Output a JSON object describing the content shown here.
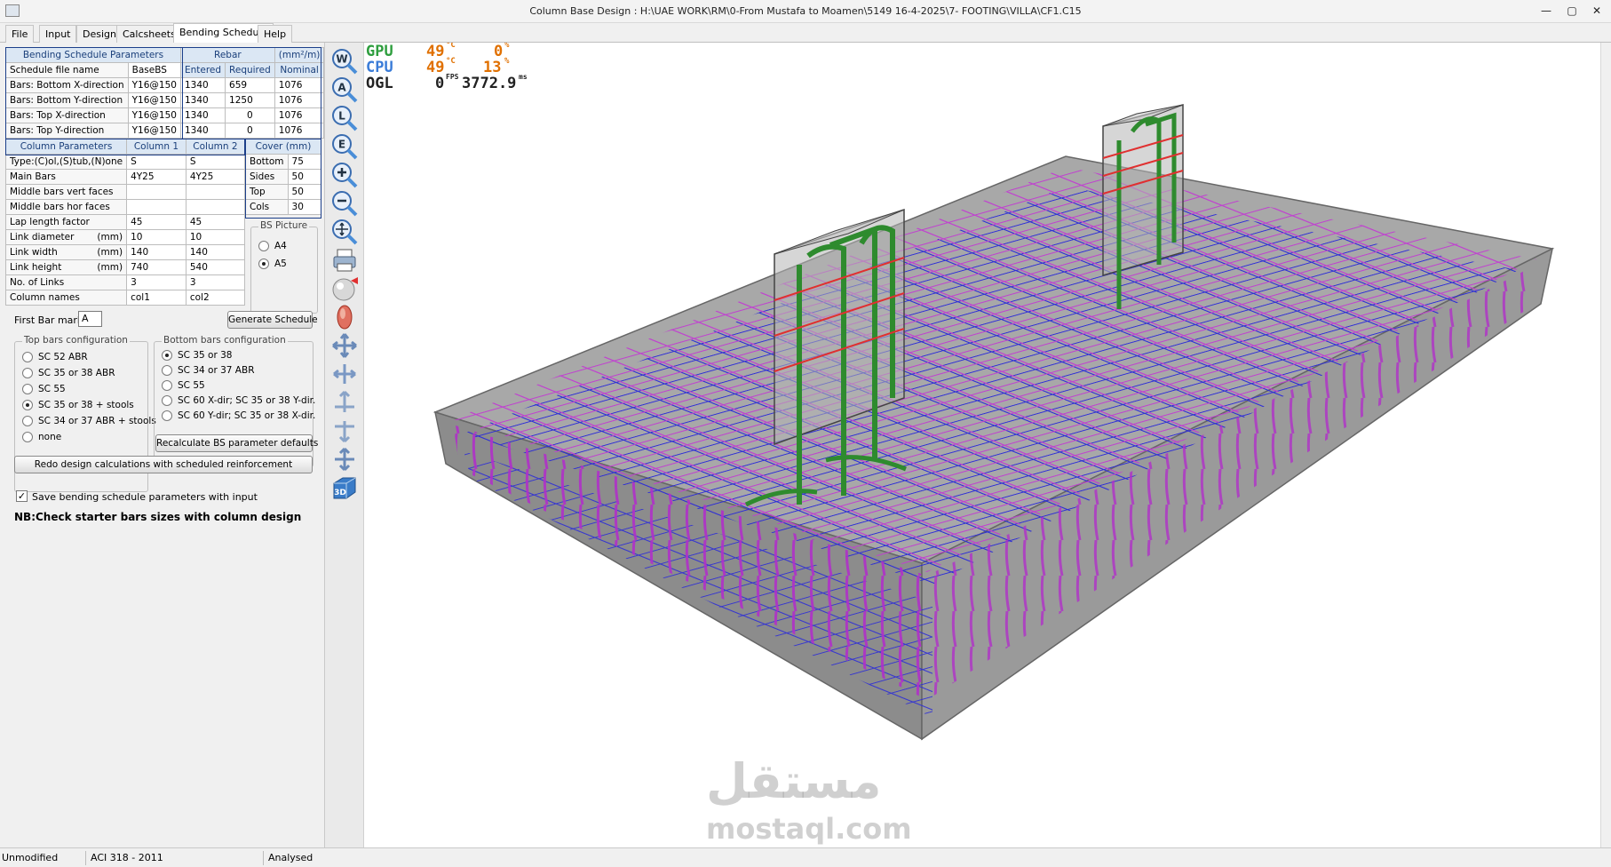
{
  "window": {
    "title": "Column Base Design :  H:\\UAE WORK\\RM\\0-From Mustafa to Moamen\\5149 16-4-2025\\7- FOOTING\\VILLA\\CF1.C15",
    "minimize": "—",
    "maximize": "▢",
    "close": "✕"
  },
  "menu": {
    "tabs": [
      {
        "label": "File"
      },
      {
        "label": "Input"
      },
      {
        "label": "Design"
      },
      {
        "label": "Calcsheets"
      },
      {
        "label": "Bending Schedule"
      },
      {
        "label": "Help"
      }
    ]
  },
  "bs_params": {
    "header": "Bending Schedule Parameters",
    "rebar_header": "Rebar",
    "unit": "(mm²/m)",
    "col_entered": "Entered",
    "col_required": "Required",
    "col_nominal": "Nominal",
    "rows": [
      {
        "label": "Schedule file name",
        "value": "BaseBS",
        "entered": "",
        "required": "",
        "nominal": ""
      },
      {
        "label": "Bars: Bottom X-direction",
        "value": "Y16@150",
        "entered": "1340",
        "required": "659",
        "nominal": "1076"
      },
      {
        "label": "Bars: Bottom Y-direction",
        "value": "Y16@150",
        "entered": "1340",
        "required": "1250",
        "nominal": "1076"
      },
      {
        "label": "Bars: Top X-direction",
        "value": "Y16@150",
        "entered": "1340",
        "required": "0",
        "nominal": "1076"
      },
      {
        "label": "Bars: Top Y-direction",
        "value": "Y16@150",
        "entered": "1340",
        "required": "0",
        "nominal": "1076"
      }
    ]
  },
  "column_params": {
    "header": "Column Parameters",
    "col1": "Column 1",
    "col2": "Column 2",
    "rows": [
      {
        "label": "Type:(C)ol,(S)tub,(N)one",
        "c1": "S",
        "c2": "S"
      },
      {
        "label": "Main Bars",
        "c1": "4Y25",
        "c2": "4Y25"
      },
      {
        "label": "Middle bars vert faces",
        "c1": "",
        "c2": ""
      },
      {
        "label": "Middle bars hor faces",
        "c1": "",
        "c2": ""
      },
      {
        "label": "Lap length factor",
        "c1": "45",
        "c2": "45"
      },
      {
        "label": "Link diameter",
        "unit": "(mm)",
        "c1": "10",
        "c2": "10"
      },
      {
        "label": "Link width",
        "unit": "(mm)",
        "c1": "140",
        "c2": "140"
      },
      {
        "label": "Link height",
        "unit": "(mm)",
        "c1": "740",
        "c2": "540"
      },
      {
        "label": "No. of Links",
        "c1": "3",
        "c2": "3"
      },
      {
        "label": "Column names",
        "c1": "col1",
        "c2": "col2"
      }
    ]
  },
  "cover": {
    "header": "Cover (mm)",
    "rows": [
      {
        "label": "Bottom",
        "value": "75"
      },
      {
        "label": "Sides",
        "value": "50"
      },
      {
        "label": "Top",
        "value": "50"
      },
      {
        "label": "Cols",
        "value": "30"
      }
    ]
  },
  "bs_picture": {
    "title": "BS Picture",
    "options": [
      {
        "label": "A4",
        "selected": false
      },
      {
        "label": "A5",
        "selected": true
      }
    ]
  },
  "first_bar_mark": {
    "label": "First Bar mark",
    "value": "A"
  },
  "generate_button": "Generate Schedule",
  "top_bars": {
    "title": "Top bars configuration",
    "options": [
      {
        "label": "SC 52 ABR",
        "selected": false
      },
      {
        "label": "SC 35 or 38 ABR",
        "selected": false
      },
      {
        "label": "SC 55",
        "selected": false
      },
      {
        "label": "SC 35 or 38 + stools",
        "selected": true
      },
      {
        "label": "SC 34 or 37 ABR + stools",
        "selected": false
      },
      {
        "label": "none",
        "selected": false
      }
    ]
  },
  "bottom_bars": {
    "title": "Bottom bars configuration",
    "options": [
      {
        "label": "SC 35 or 38",
        "selected": true
      },
      {
        "label": "SC 34 or 37 ABR",
        "selected": false
      },
      {
        "label": "SC 55",
        "selected": false
      },
      {
        "label": "SC 60 X-dir; SC 35 or 38 Y-dir.",
        "selected": false
      },
      {
        "label": "SC 60 Y-dir; SC 35 or 38 X-dir.",
        "selected": false
      }
    ]
  },
  "recalc_button": "Recalculate BS parameter defaults",
  "redo_button": "Redo design calculations with scheduled reinforcement",
  "save_checkbox": {
    "label": "Save bending schedule parameters with input",
    "checked": true
  },
  "note": "NB:Check starter bars sizes with column design",
  "toolbar": {
    "view_w": "W",
    "view_a": "A",
    "view_l": "L",
    "view_e": "E",
    "view_3d": "3D"
  },
  "overlay": {
    "gpu_label": "GPU",
    "gpu_temp": "49",
    "gpu_temp_unit": "°C",
    "gpu_load": "0",
    "gpu_load_unit": "%",
    "cpu_label": "CPU",
    "cpu_temp": "49",
    "cpu_temp_unit": "°C",
    "cpu_load": "13",
    "cpu_load_unit": "%",
    "ogl_label": "OGL",
    "ogl_fps": "0",
    "ogl_fps_unit": "FPS",
    "ogl_ms": "3772.9",
    "ogl_ms_unit": "ms"
  },
  "watermark": {
    "arabic": "مستقل",
    "latin": "mostaql.com"
  },
  "status": {
    "state": "Unmodified",
    "code": "ACI 318 - 2011",
    "analysis": "Analysed"
  },
  "colors": {
    "top_mesh": "#c040d0",
    "bottom_mesh": "#2a2ad8",
    "starter_bars": "#2e8b2e",
    "links": "#e03030",
    "concrete": "#a8a8a8"
  }
}
